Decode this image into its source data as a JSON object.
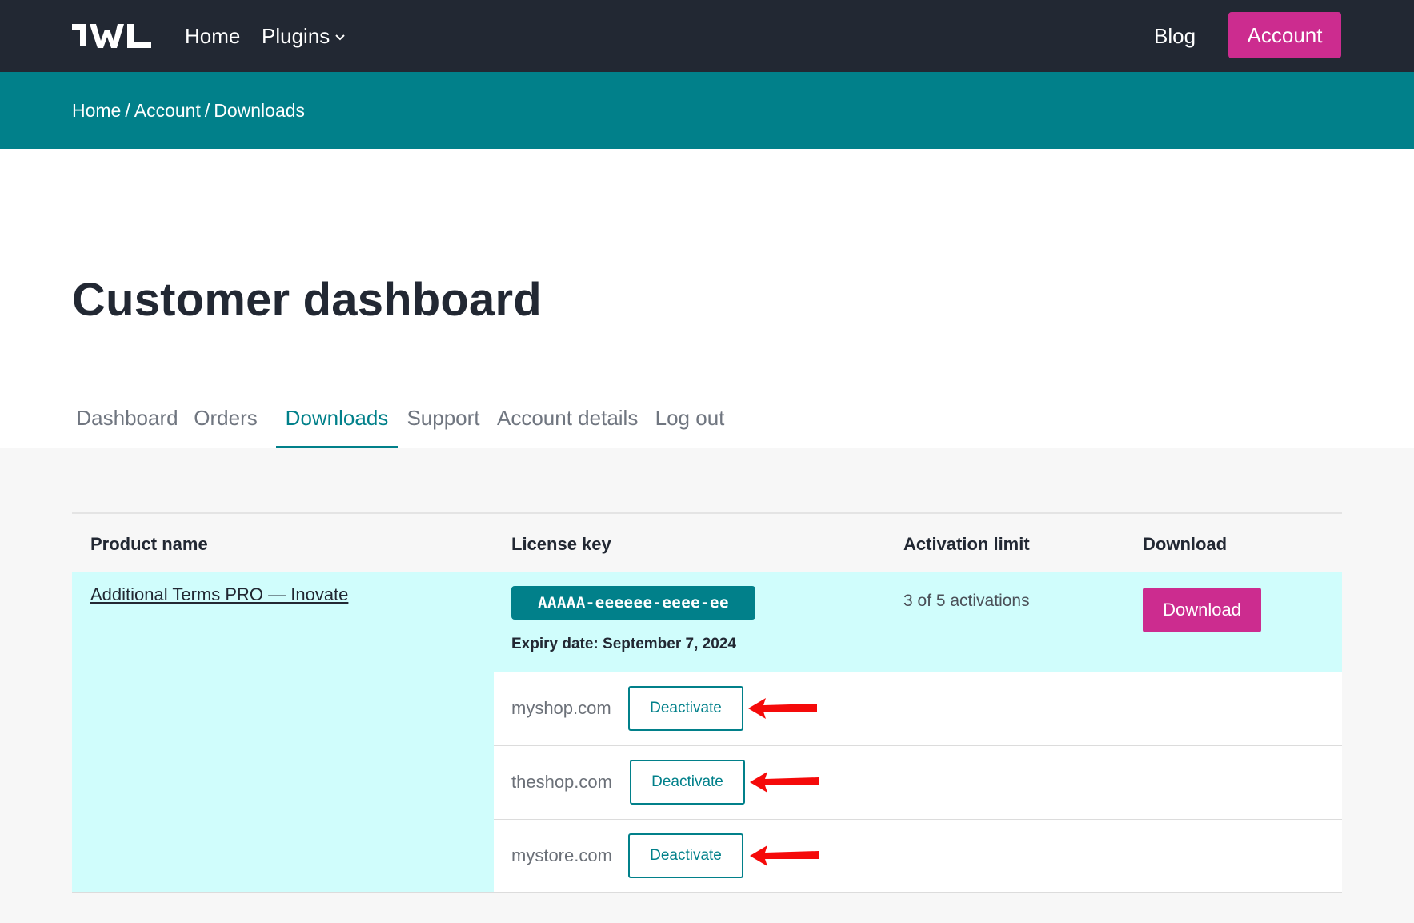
{
  "nav": {
    "logo_label": "WL",
    "home_label": "Home",
    "plugins_label": "Plugins",
    "blog_label": "Blog",
    "account_label": "Account"
  },
  "breadcrumb": {
    "items": [
      "Home",
      "Account",
      "Downloads"
    ],
    "separator": "/"
  },
  "page_title": "Customer dashboard",
  "tabs": [
    {
      "label": "Dashboard",
      "active": false
    },
    {
      "label": "Orders",
      "active": false
    },
    {
      "label": "Downloads",
      "active": true
    },
    {
      "label": "Support",
      "active": false
    },
    {
      "label": "Account details",
      "active": false
    },
    {
      "label": "Log out",
      "active": false
    }
  ],
  "table": {
    "headers": [
      "Product name",
      "License key",
      "Activation limit",
      "Download"
    ],
    "rows": [
      {
        "product_name": "Additional Terms PRO — Inovate",
        "license_key": "AAAAA-eeeeee-eeee-ee",
        "expiry": "Expiry date: September 7, 2024",
        "activation": "3 of 5 activations",
        "download_label": "Download",
        "sites": [
          {
            "domain": "myshop.com",
            "action_label": "Deactivate"
          },
          {
            "domain": "theshop.com",
            "action_label": "Deactivate"
          },
          {
            "domain": "mystore.com",
            "action_label": "Deactivate"
          }
        ]
      }
    ]
  },
  "colors": {
    "topbar": "#222833",
    "teal": "#01808a",
    "magenta": "#cc2c8f",
    "row_highlight": "#d0fdfc",
    "annotation_arrow": "#f50a0a"
  },
  "icons": {
    "plugins_dropdown": "chevron-down-icon",
    "annotation": "red-arrow-icon"
  }
}
